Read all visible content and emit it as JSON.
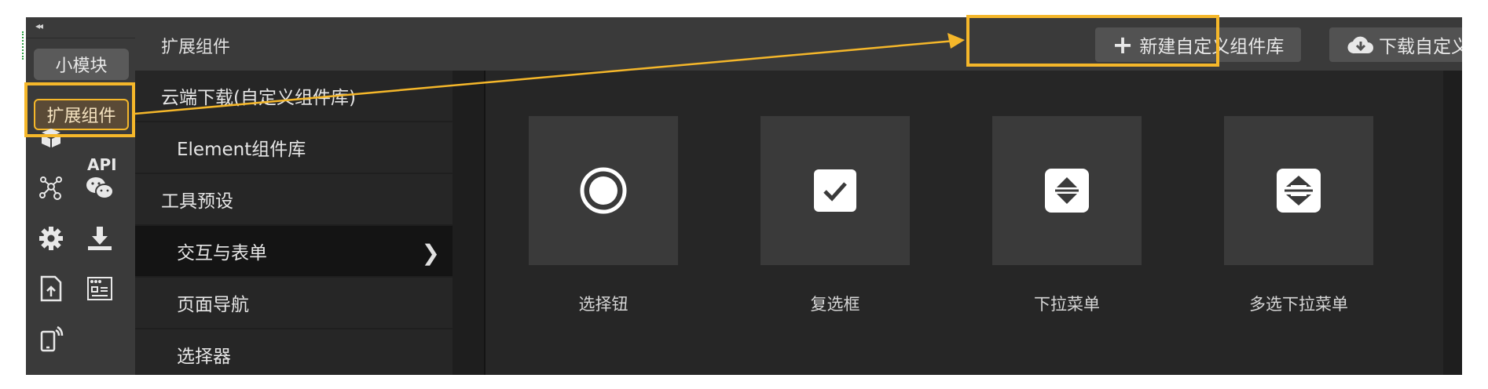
{
  "rail": {
    "collapse_glyph": "◂◂",
    "small_module_label": "小模块",
    "extension_label": "扩展组件",
    "api_label": "API",
    "icons": [
      "package-icon",
      "network-icon",
      "wechat-icon",
      "gear-icon",
      "download-icon",
      "file-upload-icon",
      "form-window-icon",
      "mobile-cast-icon"
    ]
  },
  "topbar": {
    "title": "扩展组件",
    "new_lib_button": "新建自定义组件库",
    "download_lib_button": "下载自定义组件库"
  },
  "categories": [
    {
      "label": "云端下载(自定义组件库)"
    },
    {
      "label": "Element组件库"
    },
    {
      "label": "工具预设"
    },
    {
      "label": "交互与表单"
    },
    {
      "label": "页面导航"
    },
    {
      "label": "选择器"
    }
  ],
  "components": [
    {
      "label": "选择钮",
      "icon": "radio-icon"
    },
    {
      "label": "复选框",
      "icon": "checkbox-icon"
    },
    {
      "label": "下拉菜单",
      "icon": "dropdown-icon"
    },
    {
      "label": "多选下拉菜单",
      "icon": "multi-dropdown-icon"
    }
  ],
  "colors": {
    "highlight": "#f5b72a",
    "background": "#262626",
    "panel": "#3a3a3a"
  }
}
